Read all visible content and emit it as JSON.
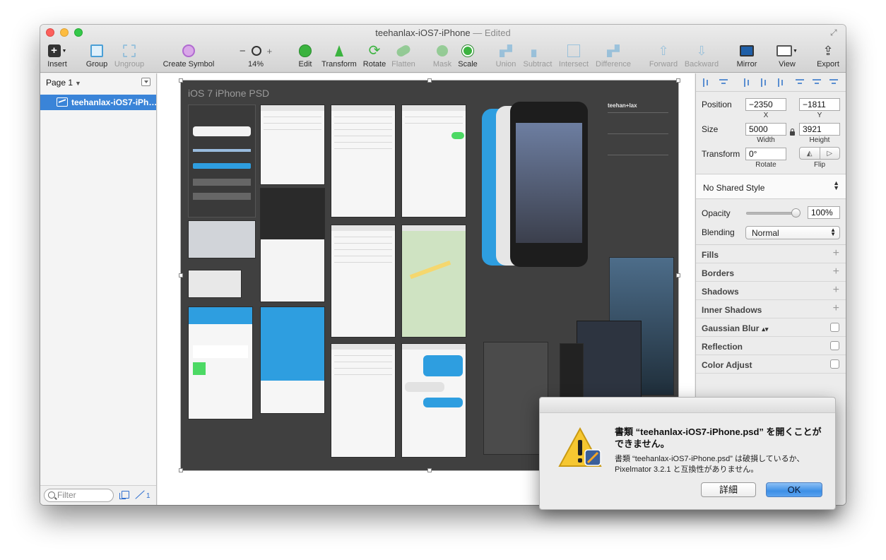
{
  "window": {
    "title": "teehanlax-iOS7-iPhone",
    "title_separator": " — ",
    "edited": "Edited"
  },
  "toolbar": {
    "insert": "Insert",
    "group": "Group",
    "ungroup": "Ungroup",
    "create_symbol": "Create Symbol",
    "zoom_minus": "−",
    "zoom_plus": "+",
    "zoom_value": "14%",
    "edit": "Edit",
    "transform": "Transform",
    "rotate": "Rotate",
    "flatten": "Flatten",
    "mask": "Mask",
    "scale": "Scale",
    "union": "Union",
    "subtract": "Subtract",
    "intersect": "Intersect",
    "difference": "Difference",
    "forward": "Forward",
    "backward": "Backward",
    "mirror": "Mirror",
    "view": "View",
    "export": "Export"
  },
  "sidebar": {
    "page_label": "Page 1",
    "layer_name": "teehanlax-iOS7-iPh…",
    "filter_placeholder": "Filter",
    "slice_count": "1"
  },
  "canvas": {
    "artboard_title": "iOS 7 iPhone PSD",
    "brand_text": "teehan+lax"
  },
  "inspector": {
    "position_label": "Position",
    "position_x": "−2350",
    "position_y": "−1811",
    "x_label": "X",
    "y_label": "Y",
    "size_label": "Size",
    "width_value": "5000",
    "height_value": "3921",
    "width_label": "Width",
    "height_label": "Height",
    "transform_label": "Transform",
    "rotate_value": "0°",
    "rotate_label": "Rotate",
    "flip_label": "Flip",
    "shared_style": "No Shared Style",
    "opacity_label": "Opacity",
    "opacity_value": "100%",
    "opacity_fraction": 1.0,
    "blending_label": "Blending",
    "blending_value": "Normal",
    "sections": {
      "fills": "Fills",
      "borders": "Borders",
      "shadows": "Shadows",
      "inner_shadows": "Inner Shadows",
      "gaussian_blur": "Gaussian Blur",
      "reflection": "Reflection",
      "color_adjust": "Color Adjust"
    }
  },
  "alert": {
    "title": "書類 “teehanlax-iOS7-iPhone.psd” を開くことができません。",
    "message": "書類 “teehanlax-iOS7-iPhone.psd” は破損しているか、Pixelmator 3.2.1 と互換性がありません。",
    "details_button": "詳細",
    "ok_button": "OK"
  },
  "colors": {
    "accent": "#3a84d8",
    "artboard": "#404040",
    "tool_green": "#3bb33f",
    "tool_blue": "#4a9fd6"
  }
}
